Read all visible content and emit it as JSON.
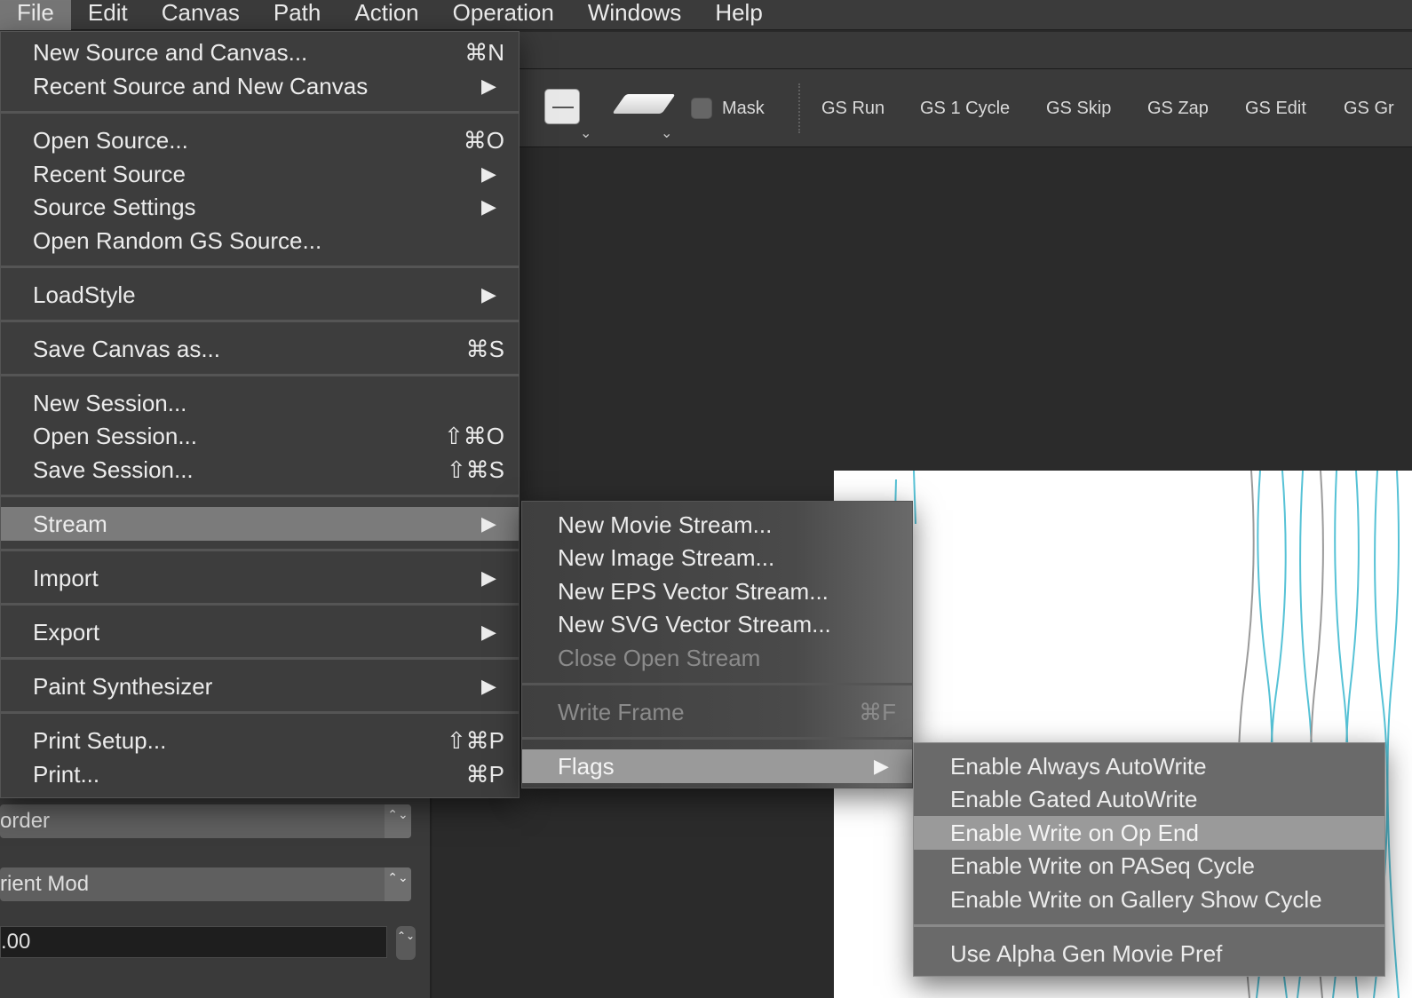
{
  "menubar": {
    "items": [
      "File",
      "Edit",
      "Canvas",
      "Path",
      "Action",
      "Operation",
      "Windows",
      "Help"
    ]
  },
  "toolbar": {
    "mask_label": "Mask",
    "buttons": [
      "GS Run",
      "GS 1 Cycle",
      "GS Skip",
      "GS Zap",
      "GS Edit",
      "GS Gr"
    ]
  },
  "file_menu": {
    "items": [
      {
        "label": "New Source and Canvas...",
        "shortcut": "⌘N"
      },
      {
        "label": "Recent Source and New Canvas",
        "submenu": true
      },
      {
        "label": "Open Source...",
        "shortcut": "⌘O"
      },
      {
        "label": "Recent Source",
        "submenu": true
      },
      {
        "label": "Source Settings",
        "submenu": true
      },
      {
        "label": "Open Random GS Source..."
      },
      {
        "label": "LoadStyle",
        "submenu": true
      },
      {
        "label": "Save Canvas as...",
        "shortcut": "⌘S"
      },
      {
        "label": "New Session..."
      },
      {
        "label": "Open Session...",
        "shortcut": "⇧⌘O"
      },
      {
        "label": "Save Session...",
        "shortcut": "⇧⌘S"
      },
      {
        "label": "Stream",
        "submenu": true,
        "highlighted": true
      },
      {
        "label": "Import",
        "submenu": true
      },
      {
        "label": "Export",
        "submenu": true
      },
      {
        "label": "Paint Synthesizer",
        "submenu": true
      },
      {
        "label": "Print Setup...",
        "shortcut": "⇧⌘P"
      },
      {
        "label": "Print...",
        "shortcut": "⌘P"
      }
    ]
  },
  "stream_menu": {
    "items": [
      {
        "label": "New Movie Stream..."
      },
      {
        "label": "New Image Stream..."
      },
      {
        "label": "New EPS Vector Stream..."
      },
      {
        "label": "New SVG Vector Stream..."
      },
      {
        "label": "Close Open Stream",
        "disabled": true
      },
      {
        "label": "Write Frame",
        "shortcut": "⌘F",
        "disabled": true
      },
      {
        "label": "Flags",
        "submenu": true,
        "highlighted": true
      }
    ]
  },
  "flags_menu": {
    "items": [
      {
        "label": "Enable Always AutoWrite"
      },
      {
        "label": "Enable Gated AutoWrite"
      },
      {
        "label": "Enable Write on Op End",
        "highlighted": true
      },
      {
        "label": "Enable Write on PASeq Cycle"
      },
      {
        "label": "Enable Write on Gallery Show Cycle"
      },
      {
        "label": "Use Alpha Gen Movie Pref"
      }
    ]
  },
  "left_panel": {
    "popup_1": "order",
    "popup_2": "rient Mod",
    "number_value": ".00"
  },
  "glyphs": {
    "submenu_arrow": "▶",
    "chevron_down": "⌄",
    "stepper": "⌃⌄"
  }
}
